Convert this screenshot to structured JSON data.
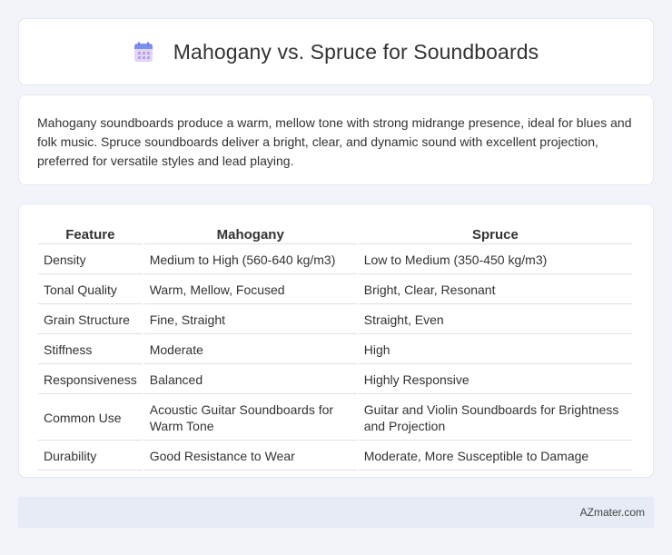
{
  "header": {
    "title": "Mahogany vs. Spruce for Soundboards",
    "icon": "calendar-icon"
  },
  "intro": {
    "text": "Mahogany soundboards produce a warm, mellow tone with strong midrange presence, ideal for blues and folk music. Spruce soundboards deliver a bright, clear, and dynamic sound with excellent projection, preferred for versatile styles and lead playing."
  },
  "table": {
    "headers": [
      "Feature",
      "Mahogany",
      "Spruce"
    ],
    "rows": [
      [
        "Density",
        "Medium to High (560-640 kg/m3)",
        "Low to Medium (350-450 kg/m3)"
      ],
      [
        "Tonal Quality",
        "Warm, Mellow, Focused",
        "Bright, Clear, Resonant"
      ],
      [
        "Grain Structure",
        "Fine, Straight",
        "Straight, Even"
      ],
      [
        "Stiffness",
        "Moderate",
        "High"
      ],
      [
        "Responsiveness",
        "Balanced",
        "Highly Responsive"
      ],
      [
        "Common Use",
        "Acoustic Guitar Soundboards for Warm Tone",
        "Guitar and Violin Soundboards for Brightness and Projection"
      ],
      [
        "Durability",
        "Good Resistance to Wear",
        "Moderate, More Susceptible to Damage"
      ]
    ]
  },
  "footer": {
    "text": "AZmater.com"
  },
  "colors": {
    "background": "#f1f4f9",
    "card": "#ffffff",
    "footer": "#e6ebf5",
    "icon_top": "#7b8ff0",
    "icon_body": "#d8c8f0"
  }
}
